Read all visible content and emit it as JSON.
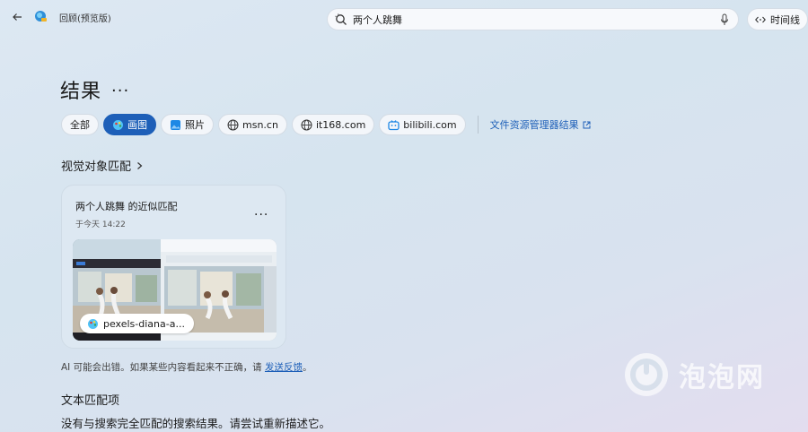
{
  "window": {
    "app_title": "回顾(预览版)"
  },
  "search": {
    "query": "两个人跳舞"
  },
  "timeline_button": {
    "label": "时间线"
  },
  "results": {
    "title": "结果",
    "more": "..."
  },
  "filters": [
    {
      "label": "全部",
      "icon": "none",
      "active": false
    },
    {
      "label": "画图",
      "icon": "paint-icon",
      "active": true
    },
    {
      "label": "照片",
      "icon": "photos-icon",
      "active": false
    },
    {
      "label": "msn.cn",
      "icon": "globe-icon",
      "active": false
    },
    {
      "label": "it168.com",
      "icon": "globe-icon",
      "active": false
    },
    {
      "label": "bilibili.com",
      "icon": "bilibili-icon",
      "active": false
    }
  ],
  "explorer_link": {
    "label": "文件资源管理器结果",
    "icon": "external-link-icon"
  },
  "visual_section": {
    "title": "视觉对象匹配"
  },
  "card": {
    "title": "两个人跳舞 的近似匹配",
    "time": "于今天 14:22",
    "more": "...",
    "file_label": "pexels-diana-a..."
  },
  "ai_note": {
    "text": "AI 可能会出错。如果某些内容看起来不正确，请",
    "link": "发送反馈",
    "suffix": "。"
  },
  "text_section": {
    "title": "文本匹配项",
    "message": "没有与搜索完全匹配的搜索结果。请尝试重新描述它。"
  },
  "watermark": {
    "text": "泡泡网"
  },
  "colors": {
    "accent": "#1d5fb8",
    "background": "#d6e4ef"
  }
}
